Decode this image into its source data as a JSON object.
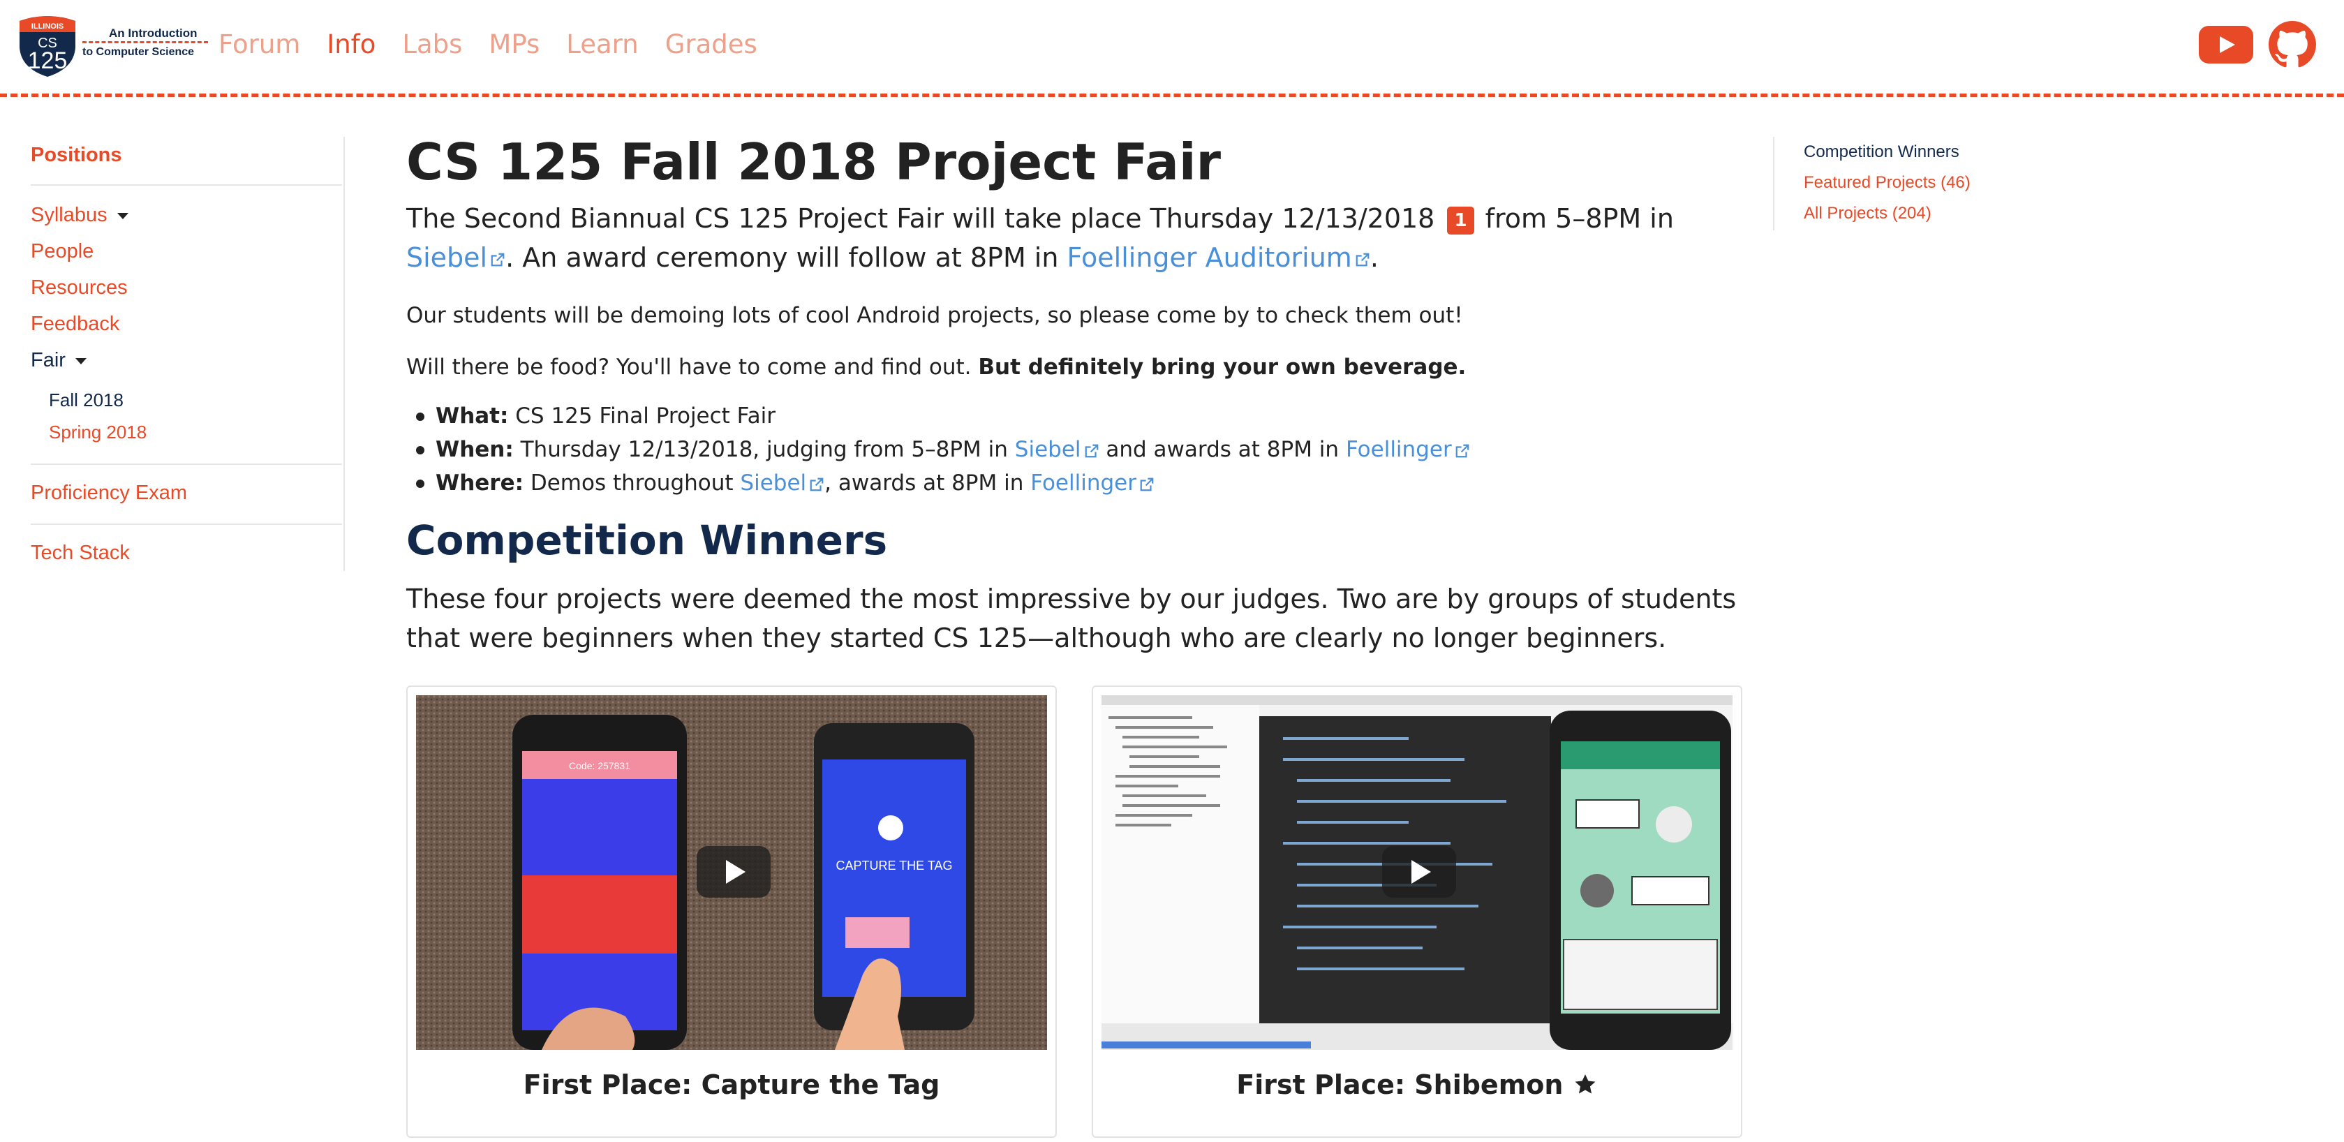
{
  "header": {
    "logo": {
      "badge_top": "ILLINOIS",
      "badge_course": "CS",
      "badge_number": "125",
      "line1": "An Introduction",
      "line2": "to Computer Science"
    },
    "nav": [
      {
        "label": "Forum",
        "active": false
      },
      {
        "label": "Info",
        "active": true
      },
      {
        "label": "Labs",
        "active": false
      },
      {
        "label": "MPs",
        "active": false
      },
      {
        "label": "Learn",
        "active": false
      },
      {
        "label": "Grades",
        "active": false
      }
    ],
    "icons": {
      "youtube": "youtube-icon",
      "github": "github-icon"
    },
    "accent_color": "#e84a27"
  },
  "sidebar": {
    "positions": "Positions",
    "syllabus": "Syllabus",
    "people": "People",
    "resources": "Resources",
    "feedback": "Feedback",
    "fair": "Fair",
    "fall2018": "Fall 2018",
    "spring2018": "Spring 2018",
    "proficiency": "Proficiency Exam",
    "techstack": "Tech Stack"
  },
  "main": {
    "title": "CS 125 Fall 2018 Project Fair",
    "lead": {
      "t1": "The Second Biannual CS 125 Project Fair will take place Thursday 12/13/2018",
      "badge": "1",
      "t2": "from 5–8PM in",
      "link1": "Siebel",
      "t3": ". An award ceremony will follow at 8PM in",
      "link2": "Foellinger Auditorium",
      "t4": "."
    },
    "p1": "Our students will be demoing lots of cool Android projects, so please come by to check them out!",
    "p2": {
      "normal": "Will there be food? You'll have to come and find out.",
      "bold": "But definitely bring your own beverage."
    },
    "bullets": {
      "what": {
        "label": "What:",
        "text": "CS 125 Final Project Fair"
      },
      "when": {
        "label": "When:",
        "t1": "Thursday 12/13/2018, judging from 5–8PM in",
        "link1": "Siebel",
        "t2": "and awards at 8PM in",
        "link2": "Foellinger"
      },
      "where": {
        "label": "Where:",
        "t1": "Demos throughout",
        "link1": "Siebel",
        "t2": ", awards at 8PM in",
        "link2": "Foellinger"
      }
    },
    "section_title": "Competition Winners",
    "section_intro": "These four projects were deemed the most impressive by our judges. Two are by groups of students that were beginners when they started CS 125—although who are clearly no longer beginners.",
    "cards": [
      {
        "caption": "First Place: Capture the Tag",
        "phone_code": "Code: 257831",
        "phone_title": "CAPTURE THE TAG"
      },
      {
        "caption": "First Place: Shibemon",
        "caption_icon": "star-icon"
      }
    ]
  },
  "toc": {
    "winners": "Competition Winners",
    "featured": "Featured Projects (46)",
    "all": "All Projects (204)"
  }
}
